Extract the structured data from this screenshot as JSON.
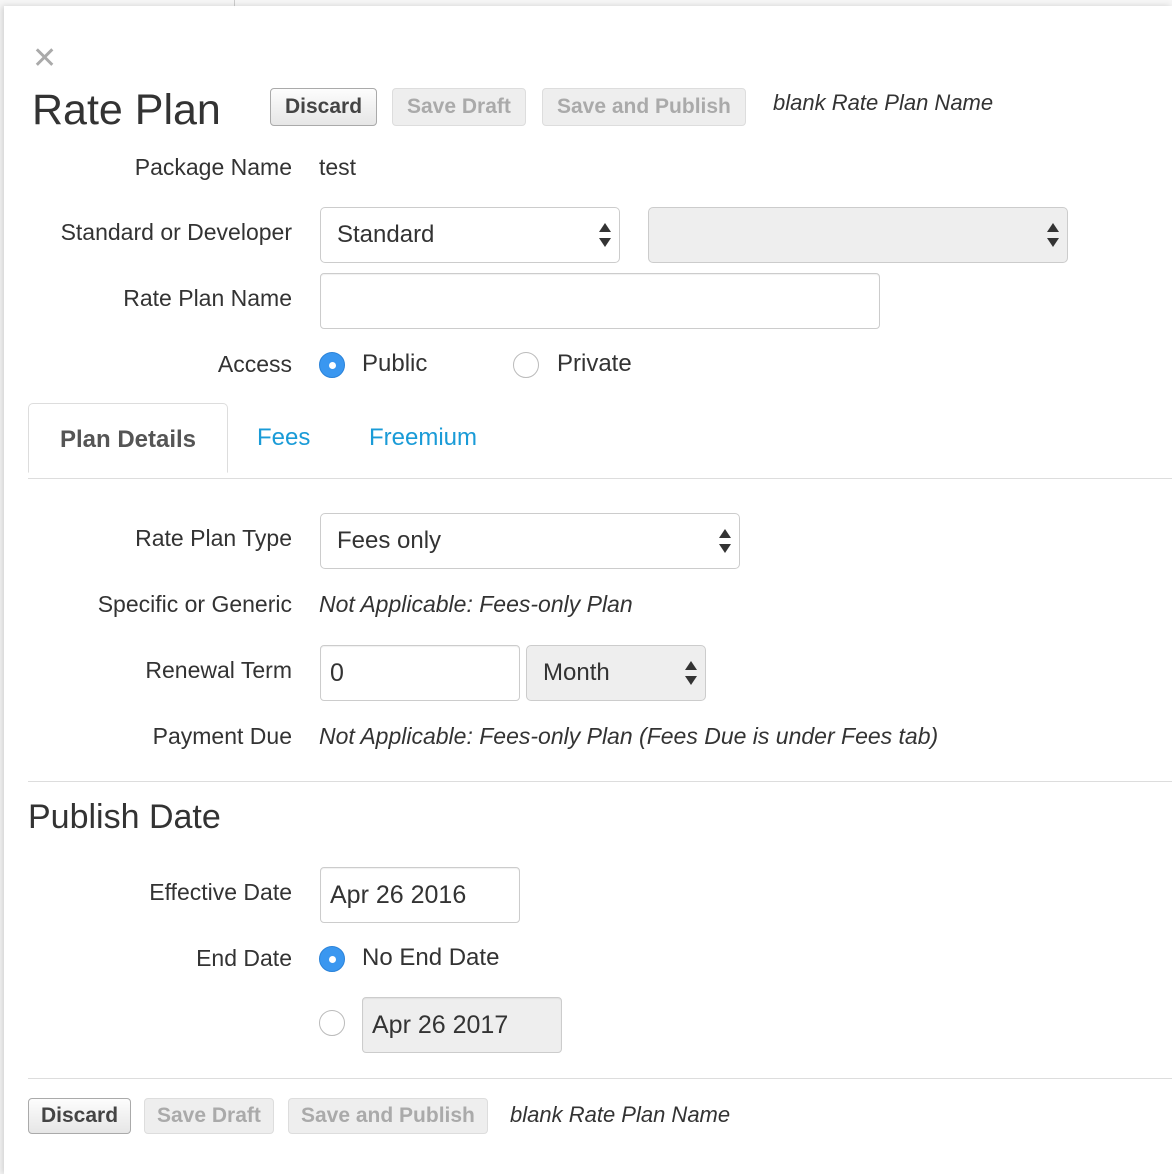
{
  "modal": {
    "title": "Rate Plan",
    "top_actions": {
      "discard": "Discard",
      "save_draft": "Save Draft",
      "save_publish": "Save and Publish",
      "note": "blank Rate Plan Name"
    },
    "bottom_actions": {
      "discard": "Discard",
      "save_draft": "Save Draft",
      "save_publish": "Save and Publish",
      "note": "blank Rate Plan Name"
    }
  },
  "form": {
    "package_name": {
      "label": "Package Name",
      "value": "test"
    },
    "standard_or_developer": {
      "label": "Standard or Developer",
      "value": "Standard",
      "secondary_value": ""
    },
    "rate_plan_name": {
      "label": "Rate Plan Name",
      "value": ""
    },
    "access": {
      "label": "Access",
      "options": [
        "Public",
        "Private"
      ],
      "selected": "Public"
    }
  },
  "tabs": [
    {
      "label": "Plan Details",
      "active": true
    },
    {
      "label": "Fees",
      "active": false
    },
    {
      "label": "Freemium",
      "active": false
    }
  ],
  "plan_details": {
    "rate_plan_type": {
      "label": "Rate Plan Type",
      "value": "Fees only"
    },
    "specific_or_generic": {
      "label": "Specific or Generic",
      "value": "Not Applicable: Fees-only Plan"
    },
    "renewal_term": {
      "label": "Renewal Term",
      "value": "0",
      "unit": "Month"
    },
    "payment_due": {
      "label": "Payment Due",
      "value": "Not Applicable: Fees-only Plan (Fees Due is under Fees tab)"
    }
  },
  "publish_date": {
    "heading": "Publish Date",
    "effective_date": {
      "label": "Effective Date",
      "value": "Apr 26 2016"
    },
    "end_date": {
      "label": "End Date",
      "no_end_label": "No End Date",
      "date_value": "Apr 26 2017",
      "selected": "no_end"
    }
  },
  "colors": {
    "link": "#1a9bd7",
    "radio_selected": "#3a97f0"
  }
}
